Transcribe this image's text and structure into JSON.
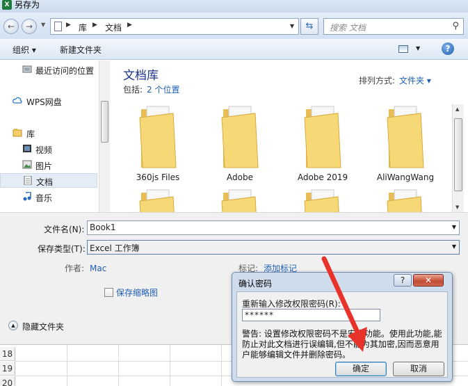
{
  "window": {
    "title": "另存为",
    "app_badge": "X"
  },
  "nav": {
    "back_glyph": "←",
    "forward_glyph": "→",
    "breadcrumb": [
      "库",
      "文档"
    ],
    "refresh_glyph": "⇆",
    "search_placeholder": "搜索 文档"
  },
  "toolbar": {
    "organize": "组织 ▾",
    "new_folder": "新建文件夹",
    "help": "?"
  },
  "sidebar": {
    "items": [
      {
        "label": "最近访问的位置",
        "icon": "recent-places-icon"
      },
      {
        "label": "WPS网盘",
        "icon": "cloud-icon"
      },
      {
        "label": "库",
        "icon": "library-icon"
      },
      {
        "label": "视频",
        "icon": "video-icon"
      },
      {
        "label": "图片",
        "icon": "picture-icon"
      },
      {
        "label": "文档",
        "icon": "document-icon",
        "selected": true
      },
      {
        "label": "音乐",
        "icon": "music-icon"
      }
    ]
  },
  "library": {
    "title": "文档库",
    "includes_label": "包括:",
    "includes_count": "2 个位置",
    "sort_label": "排列方式:",
    "sort_value": "文件夹 ▾"
  },
  "folders": [
    {
      "name": "360js Files"
    },
    {
      "name": "Adobe"
    },
    {
      "name": "Adobe 2019"
    },
    {
      "name": "AliWangWang"
    },
    {
      "name": ""
    },
    {
      "name": ""
    },
    {
      "name": ""
    },
    {
      "name": ""
    }
  ],
  "form": {
    "filename_label": "文件名(N):",
    "filename_value": "Book1",
    "filetype_label": "保存类型(T):",
    "filetype_value": "Excel 工作簿",
    "author_label": "作者:",
    "author_value": "Mac",
    "tags_label": "标记:",
    "tags_value": "添加标记",
    "thumbnail_label": "保存缩略图",
    "hide_folders": "隐藏文件夹"
  },
  "sheet": {
    "rows": [
      "18",
      "19",
      "20"
    ]
  },
  "dialog": {
    "title": "确认密码",
    "help": "?",
    "close": "✕",
    "prompt": "重新输入修改权限密码(R):",
    "password_mask": "******",
    "warning": "警告: 设置修改权限密码不是安全功能。使用此功能,能防止对此文档进行误编辑,但不能为其加密,因而恶意用户能够编辑文件并删除密码。",
    "ok": "确定",
    "cancel": "取消"
  },
  "colors": {
    "accent": "#1e5fb4",
    "arrow": "#e8332a",
    "folder": "#f3cf6a"
  }
}
